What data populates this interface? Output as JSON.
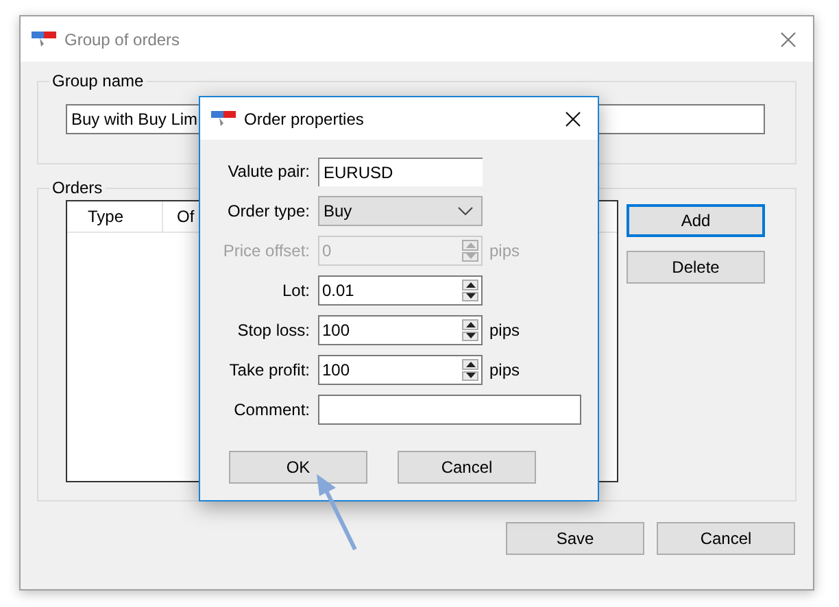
{
  "window": {
    "title": "Group of orders"
  },
  "group_name": {
    "label": "Group name",
    "value": "Buy with Buy Lim"
  },
  "orders": {
    "label": "Orders",
    "columns": [
      "Type",
      "Of"
    ],
    "buttons": [
      {
        "label": "Add",
        "focused": true
      },
      {
        "label": "Delete",
        "focused": false
      }
    ]
  },
  "buttons": [
    "Save",
    "Cancel"
  ],
  "dialog": {
    "title": "Order properties",
    "fields": [
      {
        "kind": "text",
        "label": "Valute pair:",
        "value": "EURUSD",
        "disabled": false
      },
      {
        "kind": "select",
        "label": "Order type:",
        "value": "Buy",
        "disabled": false
      },
      {
        "kind": "spin",
        "label": "Price offset:",
        "value": "0",
        "unit": "pips",
        "disabled": true
      },
      {
        "kind": "spin",
        "label": "Lot:",
        "value": "0.01",
        "disabled": false
      },
      {
        "kind": "spin",
        "label": "Stop loss:",
        "value": "100",
        "unit": "pips",
        "disabled": false
      },
      {
        "kind": "spin",
        "label": "Take profit:",
        "value": "100",
        "unit": "pips",
        "disabled": false
      },
      {
        "kind": "wide",
        "label": "Comment:",
        "disabled": false
      }
    ],
    "buttons": [
      "OK",
      "Cancel"
    ]
  }
}
